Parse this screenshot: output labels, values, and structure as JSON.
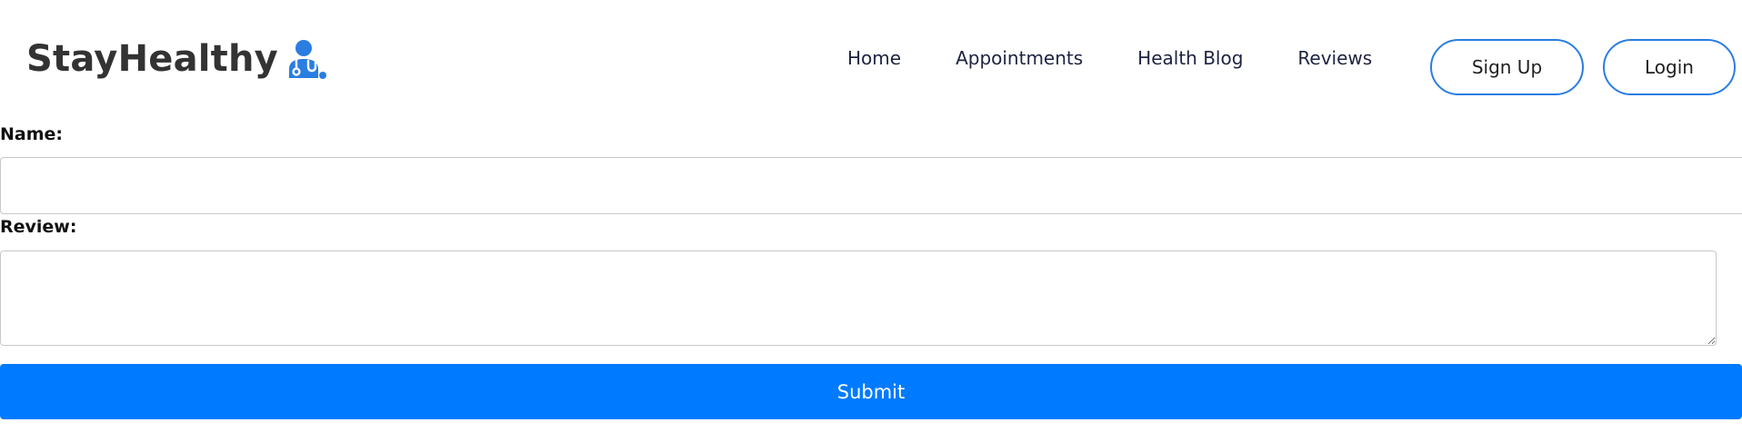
{
  "brand": {
    "name": "StayHealthy",
    "icon": "doctor-icon",
    "icon_color": "#2a7de1"
  },
  "nav": {
    "links": [
      {
        "label": "Home"
      },
      {
        "label": "Appointments"
      },
      {
        "label": "Health Blog"
      },
      {
        "label": "Reviews"
      }
    ],
    "signup_label": "Sign Up",
    "login_label": "Login",
    "button_border_color": "#2a7de1"
  },
  "form": {
    "name_label": "Name:",
    "name_value": "",
    "review_label": "Review:",
    "review_value": "",
    "submit_label": "Submit",
    "submit_color": "#007bff"
  }
}
